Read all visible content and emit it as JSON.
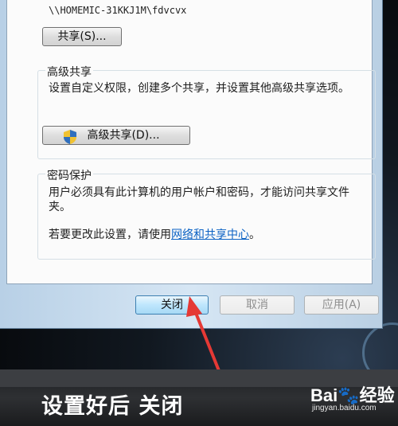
{
  "dialog": {
    "path": "\\\\HOMEMIC-31KKJ1M\\fdvcvx",
    "share_button": "共享(S)...",
    "advanced_sharing": {
      "title": "高级共享",
      "description": "设置自定义权限，创建多个共享，并设置其他高级共享选项。",
      "button": "高级共享(D)..."
    },
    "password_protection": {
      "title": "密码保护",
      "description": "用户必须具有此计算机的用户帐户和密码，才能访问共享文件夹。",
      "change_prefix": "若要更改此设置，请使用",
      "link": "网络和共享中心",
      "change_suffix": "。"
    },
    "footer": {
      "close": "关闭",
      "cancel": "取消",
      "apply": "应用(A)"
    }
  },
  "caption": "设置好后 关闭",
  "watermark": {
    "logo_text": "Bai du 经验",
    "url": "jingyan.baidu.com"
  },
  "colors": {
    "arrow": "#e53935",
    "link": "#0b62c4"
  }
}
